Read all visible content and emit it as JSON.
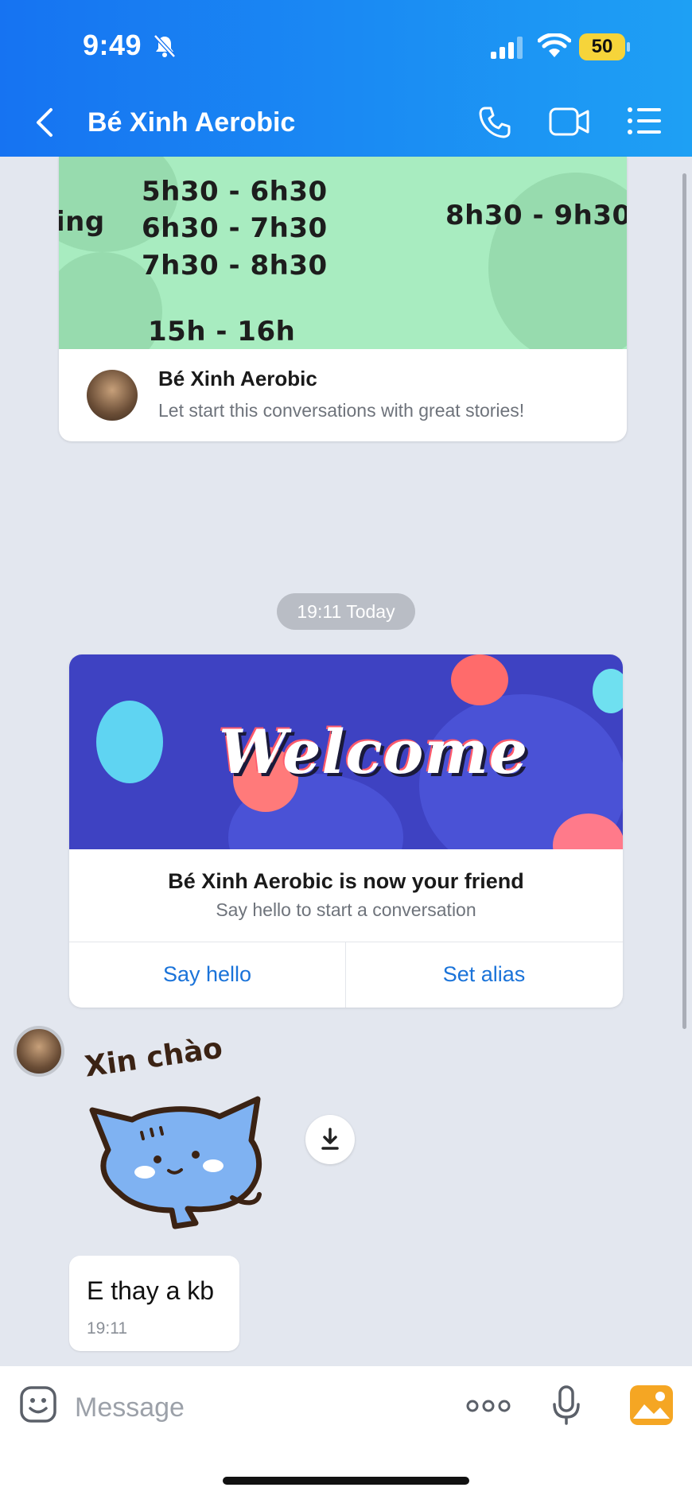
{
  "status_bar": {
    "time": "9:49",
    "battery": "50"
  },
  "header": {
    "title": "Bé Xinh Aerobic"
  },
  "story_card": {
    "schedule_left": [
      "5h30 - 6h30",
      "6h30 - 7h30",
      "7h30 - 8h30"
    ],
    "schedule_bottom": "15h - 16h",
    "schedule_right": "8h30 - 9h30",
    "schedule_fragment": "ing",
    "name": "Bé Xinh Aerobic",
    "description": "Let start this conversations with great stories!"
  },
  "date_separator": "19:11 Today",
  "welcome_card": {
    "banner_text": "Welcome",
    "title": "Bé Xinh Aerobic is now your friend",
    "subtitle": "Say hello to start a conversation",
    "say_hello_label": "Say hello",
    "set_alias_label": "Set alias"
  },
  "sticker": {
    "caption": "Xin chào"
  },
  "messages": [
    {
      "text": "E thay a kb",
      "time": "19:11"
    }
  ],
  "composer": {
    "placeholder": "Message"
  },
  "colors": {
    "header_start": "#1673f2",
    "header_end": "#1ea0f4",
    "link": "#1a73d9",
    "background": "#e3e7ef"
  }
}
